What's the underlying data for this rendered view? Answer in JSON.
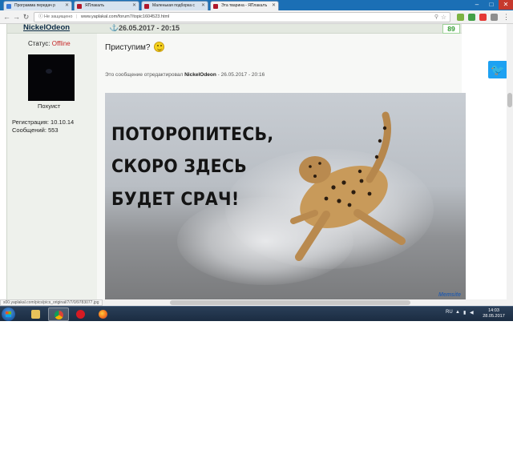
{
  "browser": {
    "tabs": [
      {
        "label": "Программа передач р",
        "active": false
      },
      {
        "label": "ЯПлакалъ",
        "active": false
      },
      {
        "label": "Маленькая подборка с",
        "active": false
      },
      {
        "label": "Эта тварина - ЯПлакалъ",
        "active": true
      }
    ],
    "window_controls": {
      "minimize": "–",
      "maximize": "□",
      "close": "✕"
    },
    "address": {
      "security_label": "Не защищено",
      "url": "www.yaplakal.com/forum7/topic1604523.html"
    },
    "status_url": "s00.yaplakal.com/pics/pics_original/7/7/0/9783077.jpg"
  },
  "post": {
    "username": "NickelOdeon",
    "date": "26.05.2017 - 20:15",
    "number": "89",
    "status_label": "Статус:",
    "status_value": "Offline",
    "user_title": "Похуист",
    "reg_label": "Регистрация:",
    "reg_date": "10.10.14",
    "msgs_label": "Сообщений:",
    "msgs_count": "553",
    "text": "Приступим?",
    "edit_prefix": "Это сообщение отредактировал",
    "edit_user": "NickelOdeon",
    "edit_suffix": "- 26.05.2017 - 20:16",
    "image_lines": [
      "ПОТОРОПИТЕСЬ,",
      "СКОРО ЗДЕСЬ",
      "БУДЕТ СРАЧ!"
    ],
    "watermark": "Memsite"
  },
  "share": {
    "twitter_glyph": "🐦"
  },
  "taskbar": {
    "lang": "RU",
    "time": "14:03",
    "date": "28.05.2017"
  },
  "colors": {
    "accent": "#1b6fb5",
    "offline": "#c62828",
    "post_number": "#2e9a2e"
  }
}
